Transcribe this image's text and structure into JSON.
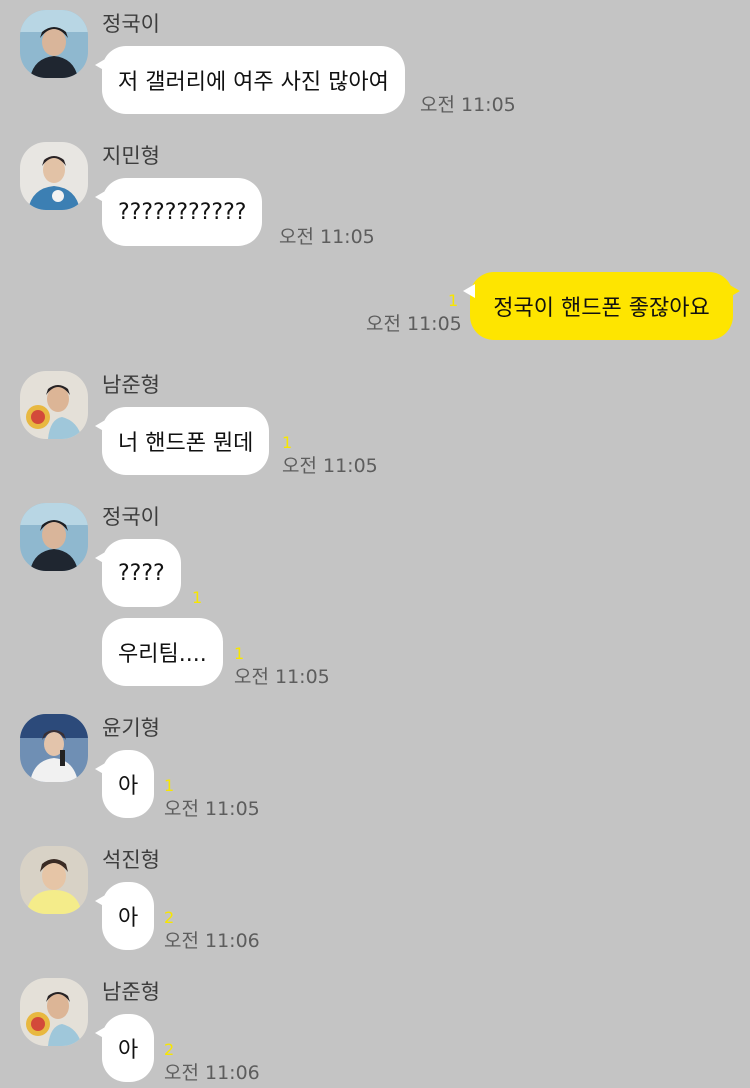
{
  "messages": [
    {
      "sender": "정국이",
      "text": "저 갤러리에 여주 사진 많아여",
      "time": "오전 11:05"
    },
    {
      "sender": "지민형",
      "text": "???????????",
      "time": "오전 11:05"
    },
    {
      "sender": "me",
      "text": "정국이 핸드폰 좋잖아요",
      "time": "오전 11:05",
      "unread": "1"
    },
    {
      "sender": "남준형",
      "text": "너 핸드폰 뭔데",
      "time": "오전 11:05",
      "unread": "1"
    },
    {
      "sender": "정국이",
      "text": "????",
      "unread": "1"
    },
    {
      "text": "우리팀....",
      "time": "오전 11:05",
      "unread": "1"
    },
    {
      "sender": "윤기형",
      "text": "아",
      "time": "오전 11:05",
      "unread": "1"
    },
    {
      "sender": "석진형",
      "text": "아",
      "time": "오전 11:06",
      "unread": "2"
    },
    {
      "sender": "남준형",
      "text": "아",
      "time": "오전 11:06",
      "unread": "2"
    }
  ],
  "colors": {
    "background": "#c4c4c4",
    "my_bubble": "#fee500",
    "other_bubble": "#ffffff",
    "unread": "#f7e600"
  }
}
